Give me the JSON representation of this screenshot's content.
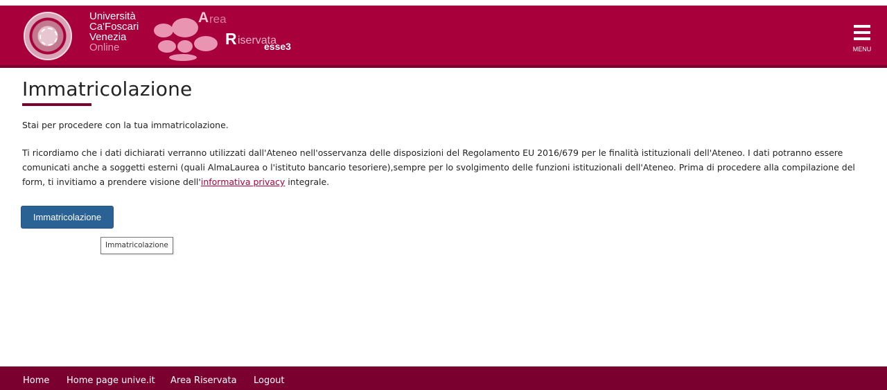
{
  "header": {
    "university_line1": "Università",
    "university_line2": "Ca'Foscari",
    "university_line3": "Venezia",
    "university_line4": "Online",
    "logo": {
      "letter_a": "A",
      "letters_rea": "rea",
      "letter_r": "R",
      "letters_iserv": "iservata",
      "esse3": "esse3"
    },
    "menu_label": "MENU",
    "brand_color": "#a8003b"
  },
  "main": {
    "title": "Immatricolazione",
    "intro": "Stai per procedere con la tua immatricolazione.",
    "paragraph_before_link": "Ti ricordiamo che i dati dichiarati verranno utilizzati dall'Ateneo nell'osservanza delle disposizioni del Regolamento EU 2016/679 per le finalità istituzionali dell'Ateneo. I dati potranno essere comunicati anche a soggetti esterni (quali AlmaLaurea o l'istituto bancario tesoriere),sempre per lo svolgimento delle funzioni istituzionali dell'Ateneo. Prima di procedere alla compilazione del form, ti invitiamo a prendere visione dell'",
    "privacy_link": "informativa privacy",
    "paragraph_after_link": " integrale.",
    "button_label": "Immatricolazione",
    "tooltip_text": "Immatricolazione"
  },
  "footer": {
    "links": [
      "Home",
      "Home page unive.it",
      "Area Riservata",
      "Logout"
    ]
  }
}
